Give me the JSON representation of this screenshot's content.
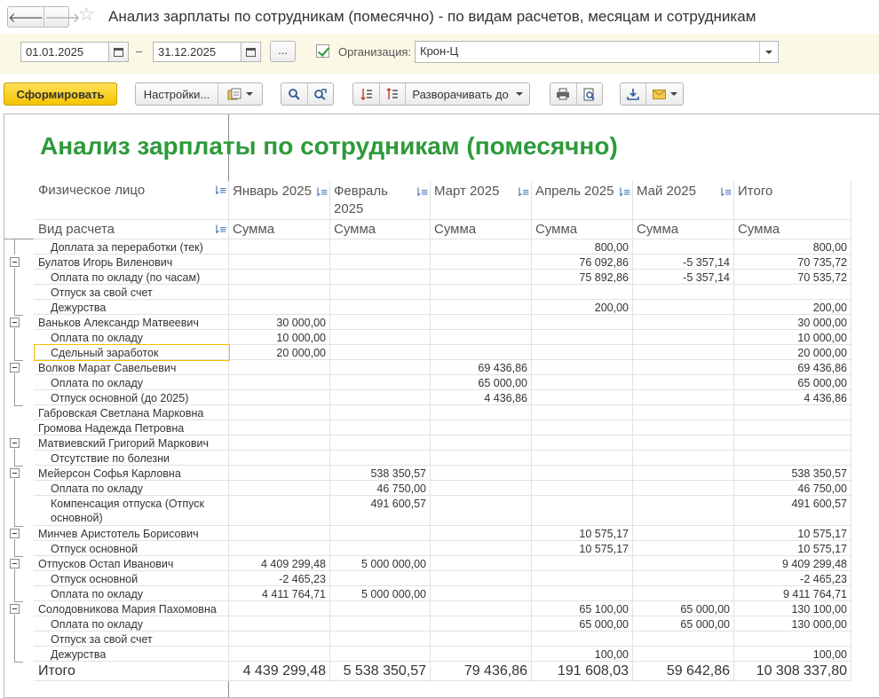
{
  "window": {
    "title": "Анализ зарплаты по сотрудникам (помесячно) - по видам расчетов, месяцам и сотрудникам",
    "back_glyph": "🡐",
    "forward_glyph": "🡒"
  },
  "params": {
    "date_from": "01.01.2025",
    "date_to": "31.12.2025",
    "dash": "–",
    "dots": "...",
    "org_label": "Организация:",
    "org_value": "Крон-Ц",
    "org_checked": true
  },
  "toolbar": {
    "generate": "Сформировать",
    "settings": "Настройки...",
    "expand": "Разворачивать до"
  },
  "report": {
    "title": "Анализ зарплаты по сотрудникам (помесячно)",
    "header": {
      "person_label": "Физическое лицо",
      "calc_label": "Вид расчета",
      "columns": [
        "Январь 2025",
        "Февраль 2025",
        "Март 2025",
        "Апрель 2025",
        "Май 2025",
        "Итого"
      ],
      "measure": "Сумма"
    },
    "rows": [
      {
        "name": "Доплата за переработки (тек)",
        "level": 2,
        "vals": [
          "",
          "",
          "",
          "800,00",
          "",
          "800,00"
        ]
      },
      {
        "name": "Булатов Игорь Виленович",
        "level": 1,
        "vals": [
          "",
          "",
          "",
          "76 092,86",
          "-5 357,14",
          "70 735,72"
        ]
      },
      {
        "name": "Оплата по окладу (по часам)",
        "level": 2,
        "vals": [
          "",
          "",
          "",
          "75 892,86",
          "-5 357,14",
          "70 535,72"
        ]
      },
      {
        "name": "Отпуск за свой счет",
        "level": 2,
        "vals": [
          "",
          "",
          "",
          "",
          "",
          ""
        ]
      },
      {
        "name": "Дежурства",
        "level": 2,
        "vals": [
          "",
          "",
          "",
          "200,00",
          "",
          "200,00"
        ]
      },
      {
        "name": "Ваньков Александр Матвеевич",
        "level": 1,
        "vals": [
          "30 000,00",
          "",
          "",
          "",
          "",
          "30 000,00"
        ]
      },
      {
        "name": "Оплата по окладу",
        "level": 2,
        "vals": [
          "10 000,00",
          "",
          "",
          "",
          "",
          "10 000,00"
        ]
      },
      {
        "name": "Сдельный заработок",
        "level": 2,
        "vals": [
          "20 000,00",
          "",
          "",
          "",
          "",
          "20 000,00"
        ]
      },
      {
        "name": "Волков Марат Савельевич",
        "level": 1,
        "vals": [
          "",
          "",
          "69 436,86",
          "",
          "",
          "69 436,86"
        ]
      },
      {
        "name": "Оплата по окладу",
        "level": 2,
        "vals": [
          "",
          "",
          "65 000,00",
          "",
          "",
          "65 000,00"
        ]
      },
      {
        "name": "Отпуск основной (до 2025)",
        "level": 2,
        "vals": [
          "",
          "",
          "4 436,86",
          "",
          "",
          "4 436,86"
        ]
      },
      {
        "name": "Габровская Светлана Марковна",
        "level": 1,
        "vals": [
          "",
          "",
          "",
          "",
          "",
          ""
        ]
      },
      {
        "name": "Громова Надежда Петровна",
        "level": 1,
        "vals": [
          "",
          "",
          "",
          "",
          "",
          ""
        ]
      },
      {
        "name": "Матвиевский Григорий Маркович",
        "level": 1,
        "vals": [
          "",
          "",
          "",
          "",
          "",
          ""
        ]
      },
      {
        "name": "Отсутствие по болезни",
        "level": 2,
        "vals": [
          "",
          "",
          "",
          "",
          "",
          ""
        ]
      },
      {
        "name": "Мейерсон Софья Карловна",
        "level": 1,
        "vals": [
          "",
          "538 350,57",
          "",
          "",
          "",
          "538 350,57"
        ]
      },
      {
        "name": "Оплата по окладу",
        "level": 2,
        "vals": [
          "",
          "46 750,00",
          "",
          "",
          "",
          "46 750,00"
        ]
      },
      {
        "name": "Компенсация отпуска (Отпуск",
        "name2": "основной)",
        "level": 2,
        "vals": [
          "",
          "491 600,57",
          "",
          "",
          "",
          "491 600,57"
        ]
      },
      {
        "name": "Минчев Аристотель Борисович",
        "level": 1,
        "vals": [
          "",
          "",
          "",
          "10 575,17",
          "",
          "10 575,17"
        ]
      },
      {
        "name": "Отпуск основной",
        "level": 2,
        "vals": [
          "",
          "",
          "",
          "10 575,17",
          "",
          "10 575,17"
        ]
      },
      {
        "name": "Отпусков Остап Иванович",
        "level": 1,
        "vals": [
          "4 409 299,48",
          "5 000 000,00",
          "",
          "",
          "",
          "9 409 299,48"
        ]
      },
      {
        "name": "Отпуск основной",
        "level": 2,
        "vals": [
          "-2 465,23",
          "",
          "",
          "",
          "",
          "-2 465,23"
        ]
      },
      {
        "name": "Оплата по окладу",
        "level": 2,
        "vals": [
          "4 411 764,71",
          "5 000 000,00",
          "",
          "",
          "",
          "9 411 764,71"
        ]
      },
      {
        "name": "Солодовникова Мария Пахомовна",
        "level": 1,
        "vals": [
          "",
          "",
          "",
          "65 100,00",
          "65 000,00",
          "130 100,00"
        ]
      },
      {
        "name": "Оплата по окладу",
        "level": 2,
        "vals": [
          "",
          "",
          "",
          "65 000,00",
          "65 000,00",
          "130 000,00"
        ]
      },
      {
        "name": "Отпуск за свой счет",
        "level": 2,
        "vals": [
          "",
          "",
          "",
          "",
          "",
          ""
        ]
      },
      {
        "name": "Дежурства",
        "level": 2,
        "vals": [
          "",
          "",
          "",
          "100,00",
          "",
          "100,00"
        ]
      }
    ],
    "totals": {
      "label": "Итого",
      "vals": [
        "4 439 299,48",
        "5 538 350,57",
        "79 436,86",
        "191 608,03",
        "59 642,86",
        "10 308 337,80"
      ]
    },
    "selected_row": 7
  }
}
